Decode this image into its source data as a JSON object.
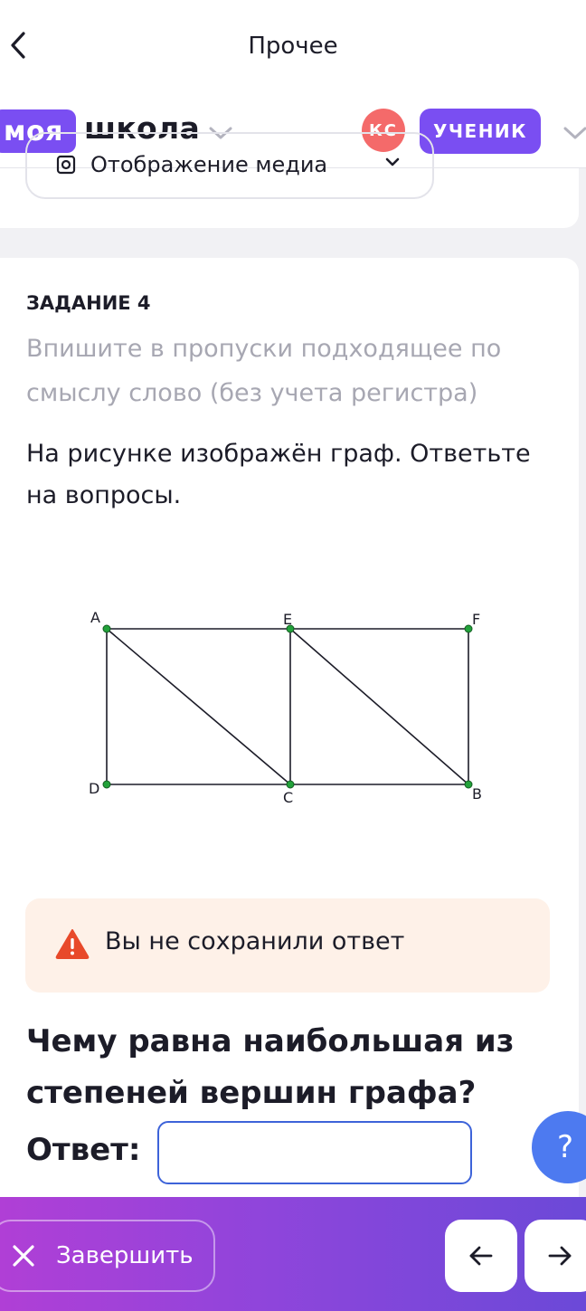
{
  "topbar": {
    "title": "Прочее"
  },
  "header": {
    "logo_part1": "моя",
    "logo_part2": "школа",
    "avatar_initials": "КС",
    "role": "УЧЕНИК"
  },
  "media": {
    "label": "Отображение медиа"
  },
  "task": {
    "number": "ЗАДАНИЕ 4",
    "hint": "Впишите в пропуски подходящее по смыслу слово (без учета регистра)",
    "text": "На рисунке изображён граф. Ответьте на вопросы.",
    "graph": {
      "vertices": [
        "A",
        "E",
        "F",
        "D",
        "C",
        "B"
      ],
      "edges": [
        [
          "A",
          "E"
        ],
        [
          "E",
          "F"
        ],
        [
          "A",
          "D"
        ],
        [
          "E",
          "C"
        ],
        [
          "F",
          "B"
        ],
        [
          "D",
          "C"
        ],
        [
          "C",
          "B"
        ],
        [
          "A",
          "C"
        ],
        [
          "E",
          "B"
        ]
      ]
    },
    "warning": "Вы не сохранили ответ",
    "question": "Чему равна наибольшая из степеней вершин графа?",
    "answer_label": "Ответ:",
    "answer_value": "",
    "answer_placeholder": ""
  },
  "help": {
    "label": "?"
  },
  "bottom": {
    "finish_label": "Завершить"
  },
  "colors": {
    "brand_purple": "#7a4ef2",
    "avatar_red": "#f46a6a",
    "input_border": "#3d63d9",
    "help_blue": "#4d7af0",
    "warning_bg": "#fef1e8",
    "warning_icon": "#e8492a",
    "vertex_green": "#22a23a"
  },
  "icons": [
    "back-chevron-icon",
    "chevron-down-icon",
    "media-settings-icon",
    "warning-triangle-icon",
    "close-icon",
    "arrow-left-icon",
    "arrow-right-icon"
  ]
}
